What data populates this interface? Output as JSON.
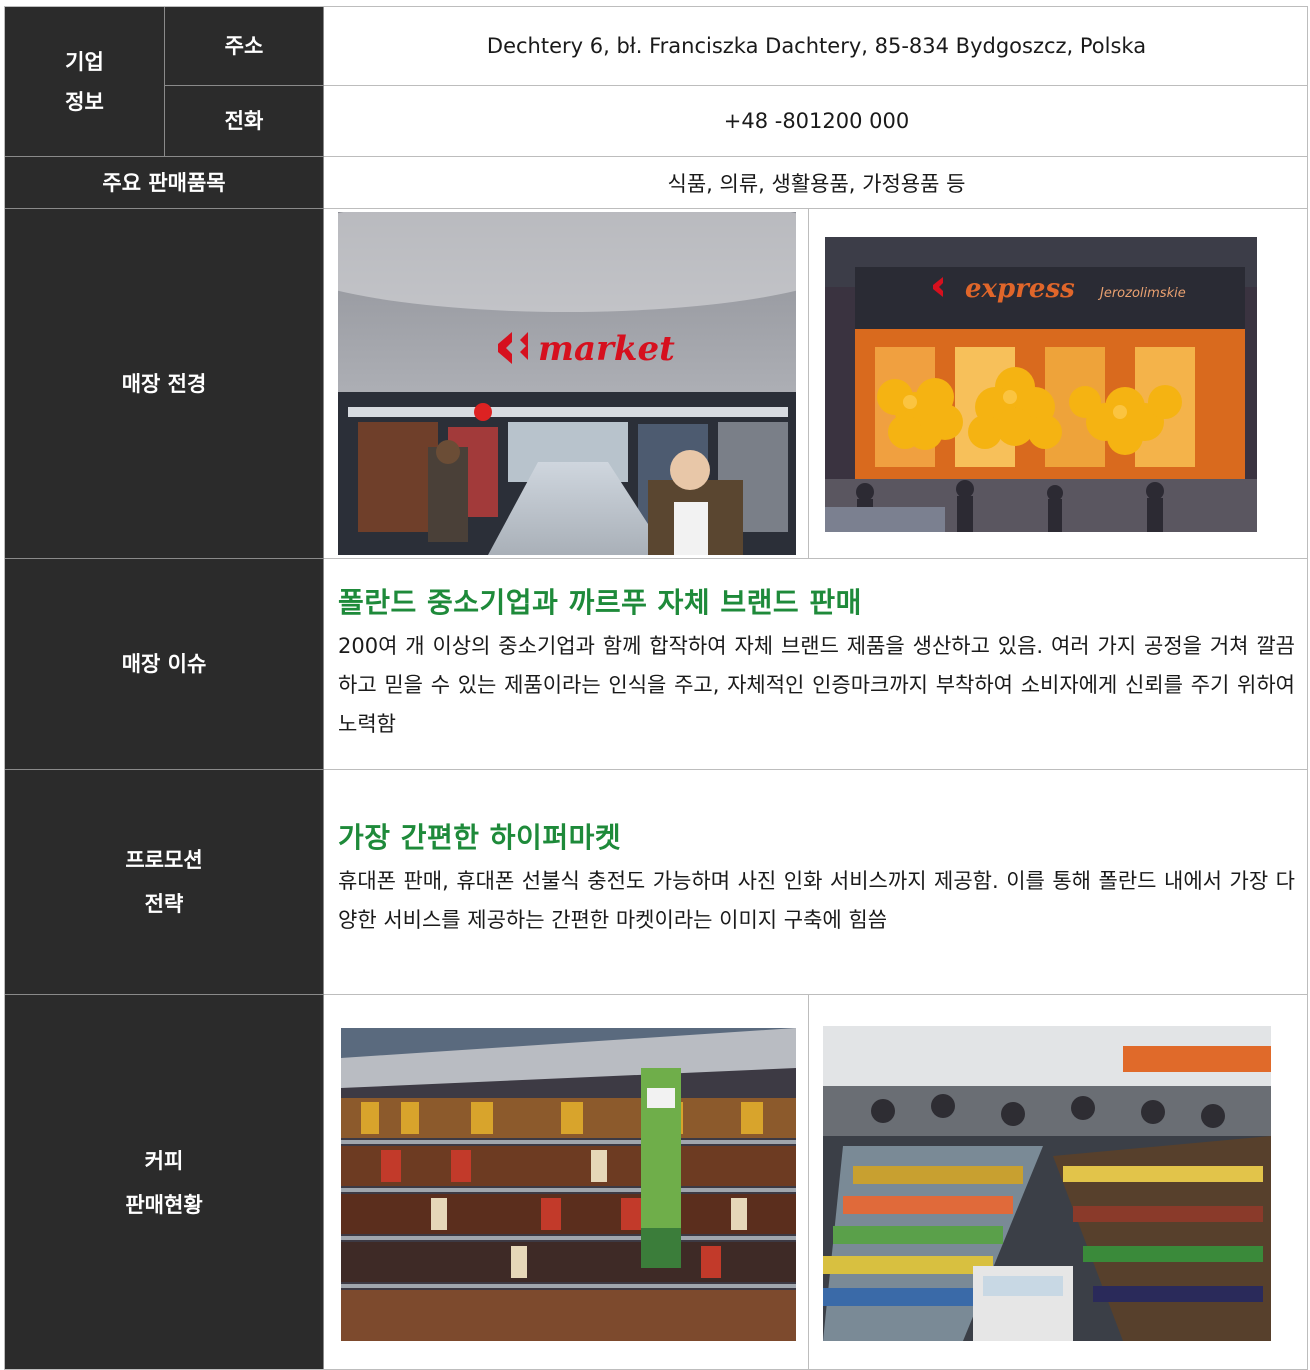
{
  "company_info": {
    "group_label": "기업\n정보",
    "address_label": "주소",
    "address_value": "Dechtery 6, bł. Franciszka Dachtery, 85-834 Bydgoszcz, Polska",
    "phone_label": "전화",
    "phone_value": "+48 -801200 000"
  },
  "main_products": {
    "label": "주요 판매품목",
    "value": "식품, 의류, 생활용품, 가정용품 등"
  },
  "store_view": {
    "label": "매장 전경",
    "photo_left_sign": "market",
    "photo_right_sign": "express",
    "photo_right_sub": "Jerozolimskie"
  },
  "store_issue": {
    "label": "매장 이슈",
    "title": "폴란드 중소기업과 까르푸 자체 브랜드 판매",
    "body": "200여 개 이상의 중소기업과 함께 합작하여 자체 브랜드 제품을 생산하고 있음. 여러 가지 공정을 거쳐 깔끔하고 믿을 수 있는 제품이라는 인식을 주고, 자체적인 인증마크까지 부착하여 소비자에게 신뢰를 주기 위하여 노력함"
  },
  "promotion": {
    "label": "프로모션\n전략",
    "title": "가장 간편한 하이퍼마켓",
    "body": "휴대폰 판매, 휴대폰 선불식 충전도 가능하며 사진 인화 서비스까지 제공함. 이를 통해 폴란드 내에서 가장 다양한 서비스를 제공하는 간편한 마켓이라는 이미지 구축에 힘씀"
  },
  "coffee_sales": {
    "label": "커피\n판매현황"
  },
  "colors": {
    "header_bg": "#2b2b2b",
    "accent_green": "#1e8a3a",
    "border": "#bdbdbd"
  }
}
